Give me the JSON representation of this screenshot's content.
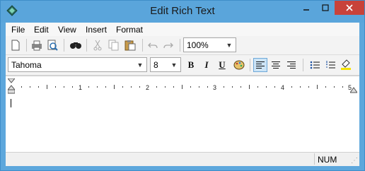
{
  "window": {
    "title": "Edit Rich Text"
  },
  "menu": {
    "file": "File",
    "edit": "Edit",
    "view": "View",
    "insert": "Insert",
    "format": "Format"
  },
  "toolbar": {
    "zoom": "100%"
  },
  "format_bar": {
    "font": "Tahoma",
    "size": "8",
    "bold": "B",
    "italic": "I",
    "underline": "U"
  },
  "ruler": {
    "numbers": [
      "1",
      "2",
      "3",
      "4",
      "5"
    ]
  },
  "status": {
    "num": "NUM"
  },
  "icons": {
    "new": "new-document-icon",
    "print": "print-icon",
    "preview": "print-preview-icon",
    "find": "find-icon",
    "cut": "cut-icon",
    "copy": "copy-icon",
    "paste": "paste-icon",
    "undo": "undo-icon",
    "redo": "redo-icon",
    "color": "color-palette-icon",
    "align_left": "align-left-icon",
    "align_center": "align-center-icon",
    "align_right": "align-right-icon",
    "bullets": "bullet-list-icon",
    "numbering": "numbered-list-icon",
    "highlight": "highlighter-icon"
  }
}
